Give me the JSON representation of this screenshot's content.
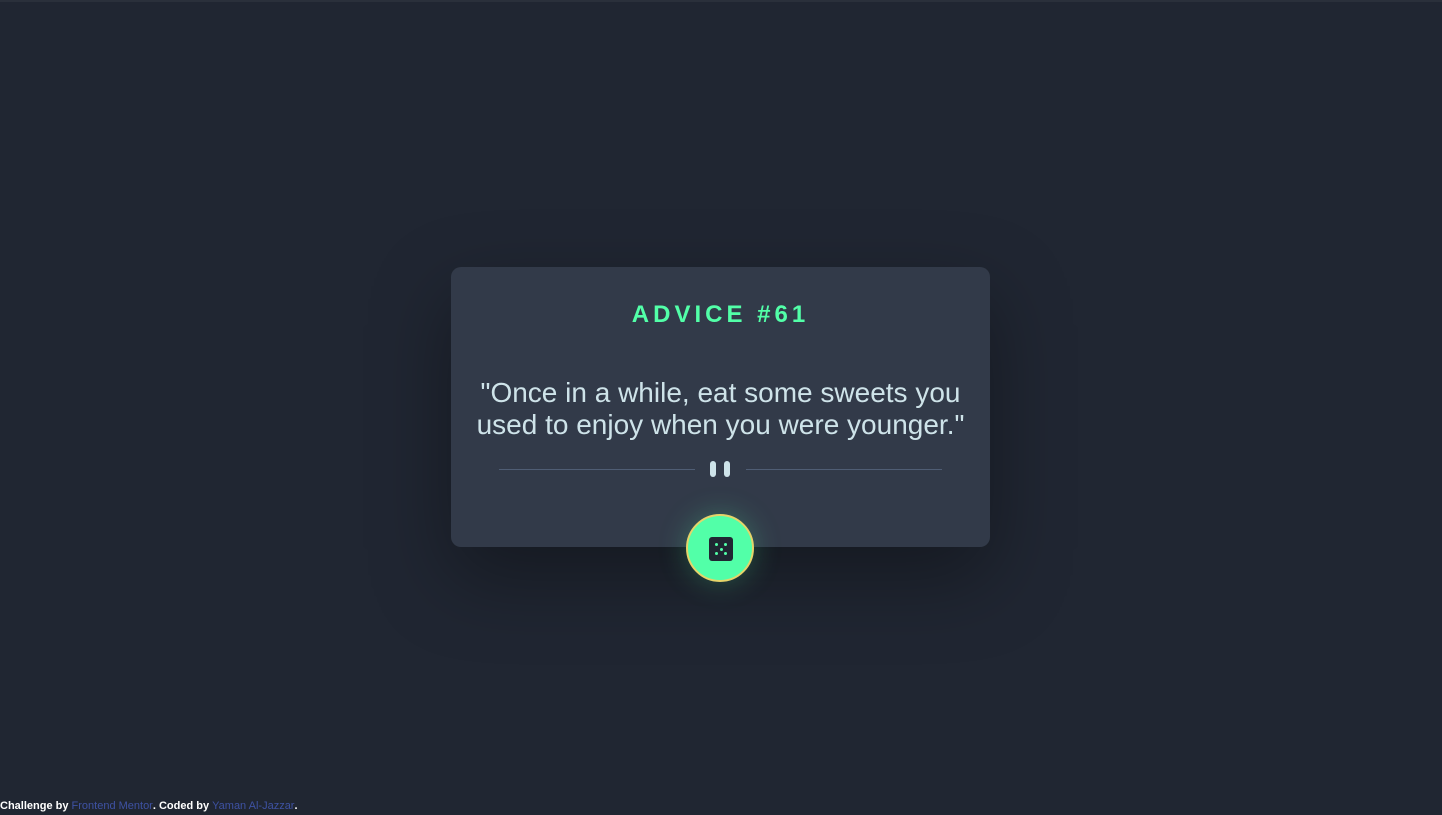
{
  "card": {
    "title": "ADVICE #61",
    "quote": "\"Once in a while, eat some sweets you used to enjoy when you were younger.\""
  },
  "icons": {
    "divider": "pause-icon",
    "button": "dice-icon"
  },
  "colors": {
    "background": "#202632",
    "card": "#323a49",
    "accent": "#52ffa8",
    "quote_text": "#cee3e9",
    "link": "#3e52a3"
  },
  "footer": {
    "prefix": "Challenge by ",
    "link1": "Frontend Mentor",
    "middle": ". Coded by ",
    "link2": "Yaman Al-Jazzar",
    "suffix": "."
  }
}
